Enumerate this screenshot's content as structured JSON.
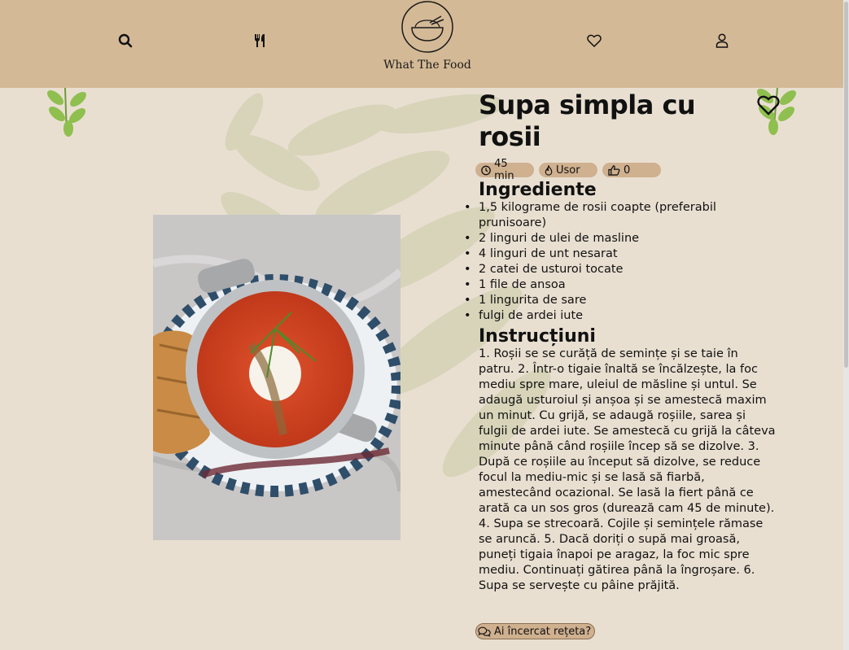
{
  "brand": {
    "name": "What The Food"
  },
  "header": {
    "icons": [
      "search-icon",
      "utensils-icon",
      "heart-icon",
      "user-icon"
    ]
  },
  "recipe": {
    "title": "Supa simpla cu rosii",
    "time": "45 min",
    "difficulty": "Usor",
    "likes": "0",
    "ingredients_heading": "Ingrediente",
    "ingredients": [
      "1,5 kilograme de rosii coapte (preferabil prunisoare)",
      "2 linguri de ulei de masline",
      "4 linguri de unt nesarat",
      "2 catei de usturoi tocate",
      "1 file de ansoa",
      "1 lingurita de sare",
      "fulgi de ardei iute"
    ],
    "instructions_heading": "Instrucțiuni",
    "instructions": "1. Roșii se se curăță de semințe și se taie în patru. 2. Într-o tigaie înaltă se încălzește, la foc mediu spre mare, uleiul de măsline și untul. Se adaugă usturoiul și anșoa și se amestecă maxim un minut. Cu grijă, se adaugă roșiile, sarea și fulgii de ardei iute. Se amestecă cu grijă la câteva minute până când roșiile încep să se dizolve. 3. După ce roșiile au început să dizolve, se reduce focul la mediu-mic și se lasă să fiarbă, amestecând ocazional. Se lasă la fiert până ce arată ca un sos gros (durează cam 45 de minute). 4. Supa se strecoară. Cojile și semințele rămase se aruncă. 5. Dacă doriți o supă mai groasă, puneți tigaia înapoi pe aragaz, la foc mic spre mediu. Continuați gătirea până la îngroșare. 6. Supa se servește cu pâine prăjită.",
    "tried_label": "Ai încercat rețeta?"
  },
  "colors": {
    "header": "#d4b996",
    "background": "#e9dfd1",
    "chip": "#cfb08f",
    "leaf": "#8fbf4f"
  }
}
